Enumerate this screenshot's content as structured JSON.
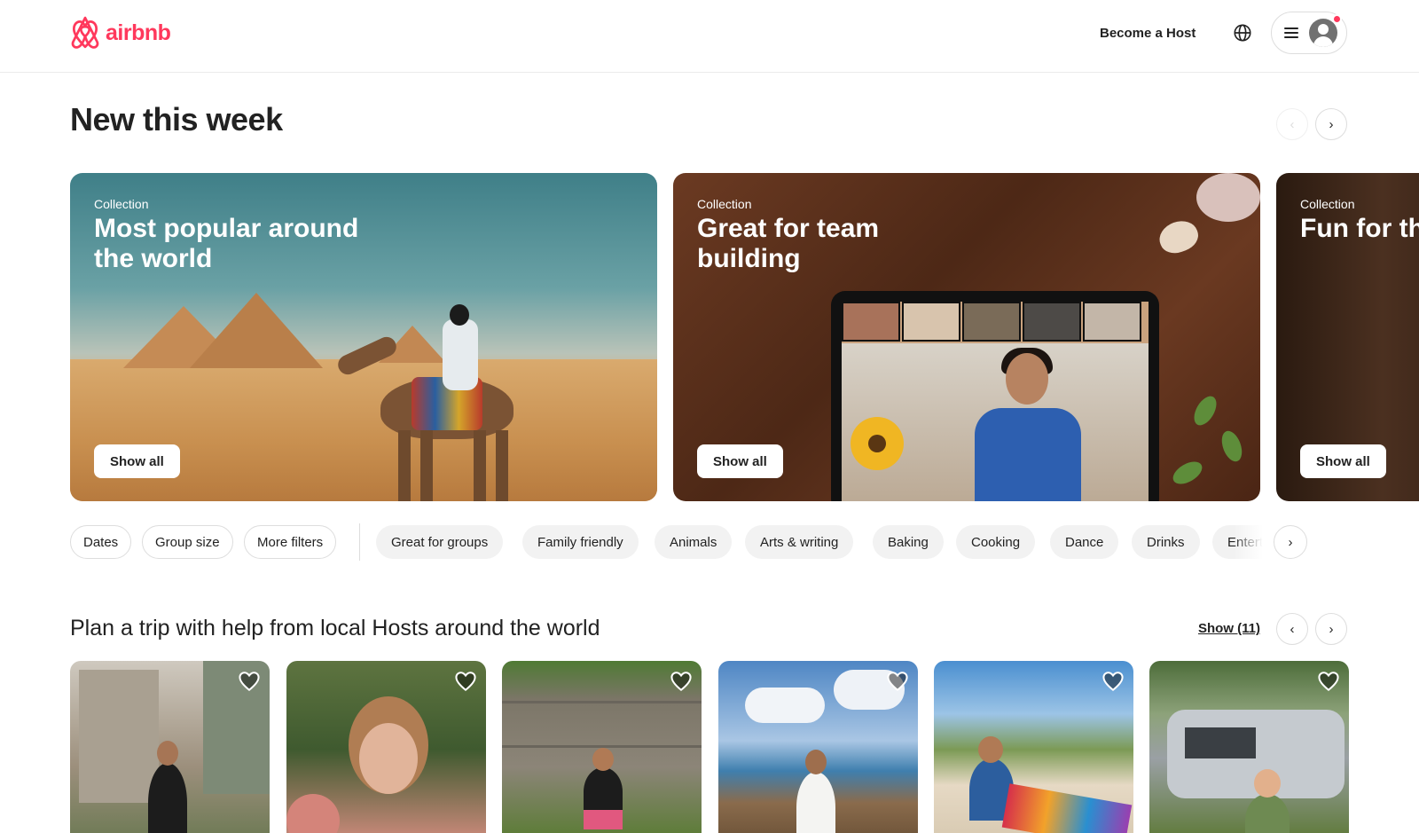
{
  "header": {
    "logo_text": "airbnb",
    "become_host": "Become a Host",
    "brand_color": "#FF385C",
    "icons": [
      "airbnb-logo-icon",
      "globe-icon",
      "hamburger-icon",
      "avatar-icon",
      "notification-dot"
    ]
  },
  "new_this_week": {
    "title": "New this week",
    "prev_icon": "‹",
    "next_icon": "›",
    "cards": [
      {
        "label": "Collection",
        "title": "Most popular around the world",
        "button": "Show all"
      },
      {
        "label": "Collection",
        "title": "Great for team building",
        "button": "Show all"
      },
      {
        "label": "Collection",
        "title": "Fun for the",
        "button": "Show all"
      }
    ]
  },
  "filters": {
    "outline": [
      "Dates",
      "Group size",
      "More filters"
    ],
    "categories": [
      "Great for groups",
      "Family friendly",
      "Animals",
      "Arts & writing",
      "Baking",
      "Cooking",
      "Dance",
      "Drinks",
      "Entert"
    ],
    "next_icon": "›"
  },
  "plan_trip": {
    "title": "Plan a trip with help from local Hosts around the world",
    "show_link": "Show (11)",
    "prev_icon": "‹",
    "next_icon": "›",
    "host_count": 6
  }
}
